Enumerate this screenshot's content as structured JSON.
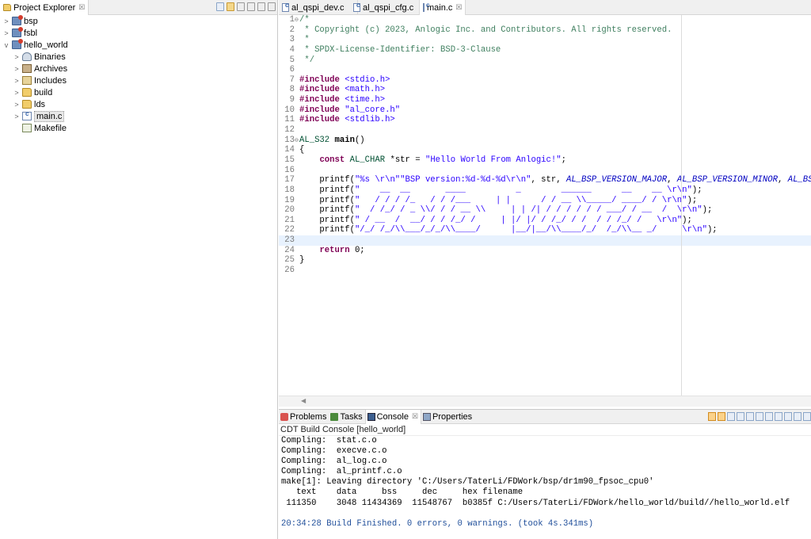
{
  "explorer": {
    "title": "Project Explorer",
    "close": "☒",
    "items": [
      {
        "label": "bsp",
        "twisty": ">",
        "icon": "project-icon",
        "indent": 0
      },
      {
        "label": "fsbl",
        "twisty": ">",
        "icon": "project-icon",
        "indent": 0
      },
      {
        "label": "hello_world",
        "twisty": "v",
        "icon": "project-icon",
        "indent": 0
      },
      {
        "label": "Binaries",
        "twisty": ">",
        "icon": "binaries-icon",
        "indent": 1
      },
      {
        "label": "Archives",
        "twisty": ">",
        "icon": "archives-icon",
        "indent": 1
      },
      {
        "label": "Includes",
        "twisty": ">",
        "icon": "includes-icon",
        "indent": 1
      },
      {
        "label": "build",
        "twisty": ">",
        "icon": "folder-icon",
        "indent": 1
      },
      {
        "label": "lds",
        "twisty": ">",
        "icon": "folder-icon",
        "indent": 1
      },
      {
        "label": "main.c",
        "twisty": ">",
        "icon": "c-file-icon",
        "indent": 1,
        "selected": true
      },
      {
        "label": "Makefile",
        "twisty": "",
        "icon": "makefile-icon",
        "indent": 1
      }
    ]
  },
  "editor": {
    "tabs": [
      {
        "label": "al_qspi_dev.c",
        "active": false
      },
      {
        "label": "al_qspi_cfg.c",
        "active": false
      },
      {
        "label": "main.c",
        "active": true,
        "close": "☒"
      }
    ],
    "current_line": 23,
    "lines": [
      {
        "n": "1",
        "fold": "⊖",
        "parts": [
          [
            "c-comment",
            "/*"
          ]
        ]
      },
      {
        "n": "2",
        "parts": [
          [
            "c-comment",
            " * Copyright (c) 2023, Anlogic Inc. and Contributors. All rights reserved."
          ]
        ]
      },
      {
        "n": "3",
        "parts": [
          [
            "c-comment",
            " *"
          ]
        ]
      },
      {
        "n": "4",
        "parts": [
          [
            "c-comment",
            " * SPDX-License-Identifier: BSD-3-Clause"
          ]
        ]
      },
      {
        "n": "5",
        "parts": [
          [
            "c-comment",
            " */"
          ]
        ]
      },
      {
        "n": "6",
        "parts": []
      },
      {
        "n": "7",
        "parts": [
          [
            "c-pre",
            "#include"
          ],
          [
            "",
            " "
          ],
          [
            "c-inc",
            "<stdio.h>"
          ]
        ]
      },
      {
        "n": "8",
        "parts": [
          [
            "c-pre",
            "#include"
          ],
          [
            "",
            " "
          ],
          [
            "c-inc",
            "<math.h>"
          ]
        ]
      },
      {
        "n": "9",
        "parts": [
          [
            "c-pre",
            "#include"
          ],
          [
            "",
            " "
          ],
          [
            "c-inc",
            "<time.h>"
          ]
        ]
      },
      {
        "n": "10",
        "parts": [
          [
            "c-pre",
            "#include"
          ],
          [
            "",
            " "
          ],
          [
            "c-inc",
            "\"al_core.h\""
          ]
        ]
      },
      {
        "n": "11",
        "parts": [
          [
            "c-pre",
            "#include"
          ],
          [
            "",
            " "
          ],
          [
            "c-inc",
            "<stdlib.h>"
          ]
        ]
      },
      {
        "n": "12",
        "parts": []
      },
      {
        "n": "13",
        "fold": "⊖",
        "parts": [
          [
            "c-type",
            "AL_S32"
          ],
          [
            "",
            " "
          ],
          [
            "c-fn",
            "main"
          ],
          [
            "",
            "()"
          ]
        ]
      },
      {
        "n": "14",
        "parts": [
          [
            "",
            "{"
          ]
        ]
      },
      {
        "n": "15",
        "parts": [
          [
            "",
            "    "
          ],
          [
            "c-kw",
            "const"
          ],
          [
            "",
            " "
          ],
          [
            "c-type",
            "AL_CHAR"
          ],
          [
            "",
            " *str = "
          ],
          [
            "c-str",
            "\"Hello World From Anlogic!\""
          ],
          [
            "",
            ";"
          ]
        ]
      },
      {
        "n": "16",
        "parts": []
      },
      {
        "n": "17",
        "parts": [
          [
            "",
            "    printf("
          ],
          [
            "c-str",
            "\"%s \\r\\n\"\"BSP version:%d-%d-%d\\r\\n\""
          ],
          [
            "",
            ", str, "
          ],
          [
            "c-macro",
            "AL_BSP_VERSION_MAJOR"
          ],
          [
            "",
            ", "
          ],
          [
            "c-macro",
            "AL_BSP_VERSION_MINOR"
          ],
          [
            "",
            ", "
          ],
          [
            "c-macro",
            "AL_BSP_VERSION_PATCH"
          ],
          [
            "",
            ");"
          ]
        ]
      },
      {
        "n": "18",
        "parts": [
          [
            "",
            "    printf("
          ],
          [
            "c-str",
            "\"    __  __       ____          _        ______      __    __ \\r\\n\""
          ],
          [
            "",
            ");"
          ]
        ]
      },
      {
        "n": "19",
        "parts": [
          [
            "",
            "    printf("
          ],
          [
            "c-str",
            "\"   / / / /_   / / /___     | |      / / __ \\\\_____/ ____/ / \\r\\n\""
          ],
          [
            "",
            ");"
          ]
        ]
      },
      {
        "n": "20",
        "parts": [
          [
            "",
            "    printf("
          ],
          [
            "c-str",
            "\"  / /_/ / _ \\\\/ / / __ \\\\     | | /| / / / / / / ___/ / __  /  \\r\\n\""
          ],
          [
            "",
            ");"
          ]
        ]
      },
      {
        "n": "21",
        "parts": [
          [
            "",
            "    printf("
          ],
          [
            "c-str",
            "\" / __  /  __/ / / /_/ /     | |/ |/ / /_/ / /  / / /_/ /   \\r\\n\""
          ],
          [
            "",
            ");"
          ]
        ]
      },
      {
        "n": "22",
        "parts": [
          [
            "",
            "    printf("
          ],
          [
            "c-str",
            "\"/_/ /_/\\\\___/_/_/\\\\____/      |__/|__/\\\\____/_/  /_/\\\\__ _/     \\r\\n\""
          ],
          [
            "",
            ");"
          ]
        ]
      },
      {
        "n": "23",
        "parts": []
      },
      {
        "n": "24",
        "parts": [
          [
            "",
            "    "
          ],
          [
            "c-kw",
            "return"
          ],
          [
            "",
            " 0;"
          ]
        ]
      },
      {
        "n": "25",
        "parts": [
          [
            "",
            "}"
          ]
        ]
      },
      {
        "n": "26",
        "parts": []
      }
    ],
    "scroll_arrow": "◀"
  },
  "console": {
    "tabs": [
      {
        "label": "Problems",
        "icon": "problems-icon",
        "active": false
      },
      {
        "label": "Tasks",
        "icon": "tasks-icon",
        "active": false
      },
      {
        "label": "Console",
        "icon": "console-icon",
        "active": true,
        "close": "☒"
      },
      {
        "label": "Properties",
        "icon": "properties-icon",
        "active": false
      }
    ],
    "title": "CDT Build Console [hello_world]",
    "lines": [
      {
        "text": "Compling:  stat.c.o",
        "kind": ""
      },
      {
        "text": "Compling:  execve.c.o",
        "kind": ""
      },
      {
        "text": "Compling:  al_log.c.o",
        "kind": ""
      },
      {
        "text": "Compling:  al_printf.c.o",
        "kind": ""
      },
      {
        "text": "make[1]: Leaving directory 'C:/Users/TaterLi/FDWork/bsp/dr1m90_fpsoc_cpu0'",
        "kind": ""
      },
      {
        "text": "   text    data     bss     dec     hex filename",
        "kind": ""
      },
      {
        "text": " 111350    3048 11434369  11548767  b0385f C:/Users/TaterLi/FDWork/hello_world/build//hello_world.elf",
        "kind": ""
      },
      {
        "text": "",
        "kind": ""
      },
      {
        "text": "20:34:28 Build Finished. 0 errors, 0 warnings. (took 4s.341ms)",
        "kind": "info"
      }
    ]
  }
}
